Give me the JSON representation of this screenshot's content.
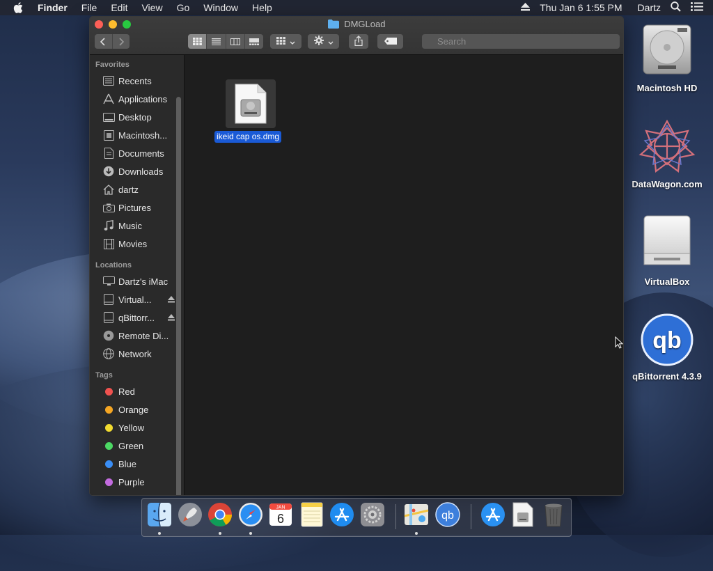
{
  "menubar": {
    "apple_icon": "apple-icon",
    "app": "Finder",
    "menus": [
      "File",
      "Edit",
      "View",
      "Go",
      "Window",
      "Help"
    ],
    "clock": "Thu Jan 6  1:55 PM",
    "user": "Dartz"
  },
  "window": {
    "title": "DMGLoad",
    "search_placeholder": "Search"
  },
  "sidebar": {
    "favorites_header": "Favorites",
    "favorites": [
      "Recents",
      "Applications",
      "Desktop",
      "Macintosh...",
      "Documents",
      "Downloads",
      "dartz",
      "Pictures",
      "Music",
      "Movies"
    ],
    "locations_header": "Locations",
    "locations": [
      "Dartz's iMac",
      "Virtual...",
      "qBittorr...",
      "Remote Di...",
      "Network"
    ],
    "tags_header": "Tags",
    "tags": [
      {
        "label": "Red",
        "color": "#f0524f"
      },
      {
        "label": "Orange",
        "color": "#f5a623"
      },
      {
        "label": "Yellow",
        "color": "#f2dc30"
      },
      {
        "label": "Green",
        "color": "#4cd964"
      },
      {
        "label": "Blue",
        "color": "#3a8ef6"
      },
      {
        "label": "Purple",
        "color": "#c36bdf"
      }
    ]
  },
  "content": {
    "file_name": "ikeid cap os.dmg"
  },
  "desktop": {
    "icons": [
      "Macintosh HD",
      "DataWagon.com",
      "VirtualBox",
      "qBittorrent 4.3.9"
    ]
  },
  "dock": {
    "items": [
      "finder-icon",
      "launchpad-icon",
      "chrome-icon",
      "safari-icon",
      "calendar-icon",
      "notes-icon",
      "app-store-icon",
      "system-preferences-icon",
      "maps-icon",
      "qbittorrent-icon",
      "app-store-icon",
      "disk-image-icon",
      "trash-icon"
    ],
    "calendar_month": "JAN",
    "calendar_day": "6",
    "qbittorrent_label": "qb"
  }
}
